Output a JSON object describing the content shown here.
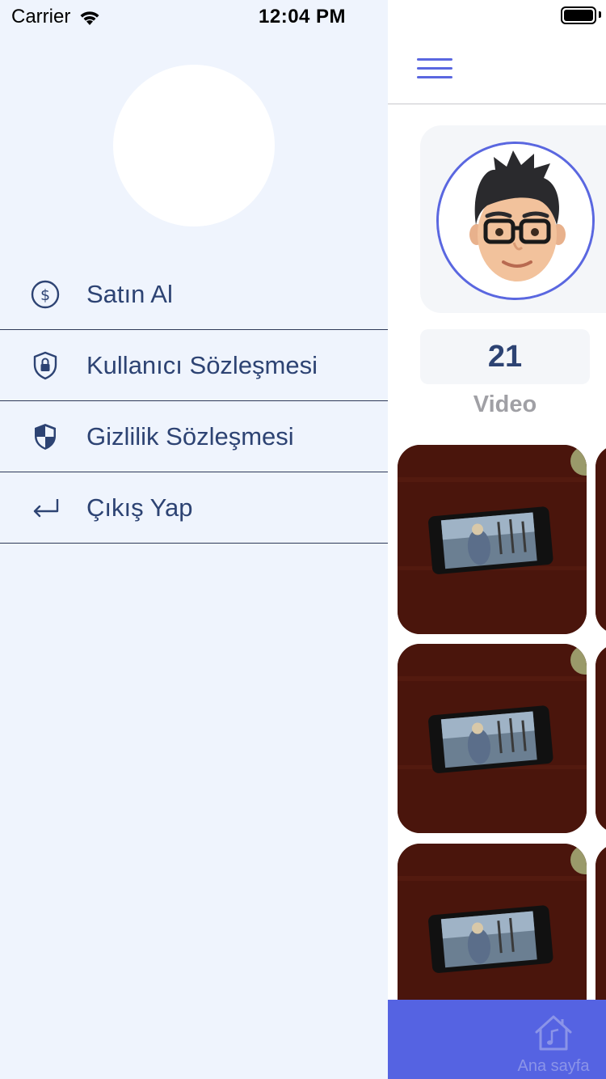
{
  "status_bar": {
    "carrier": "Carrier",
    "time": "12:04 PM"
  },
  "drawer": {
    "menu": [
      {
        "label": "Satın Al",
        "icon": "dollar-circle-icon"
      },
      {
        "label": "Kullanıcı Sözleşmesi",
        "icon": "lock-shield-icon"
      },
      {
        "label": "Gizlilik Sözleşmesi",
        "icon": "shield-icon"
      },
      {
        "label": "Çıkış Yap",
        "icon": "return-arrow-icon"
      }
    ]
  },
  "profile": {
    "video_count": "21",
    "video_label": "Video"
  },
  "tabbar": {
    "home_label": "Ana sayfa",
    "home_icon": "home-music-icon"
  },
  "colors": {
    "accent": "#5563e2",
    "text": "#2d4373",
    "drawer_bg": "#eff4fd"
  }
}
